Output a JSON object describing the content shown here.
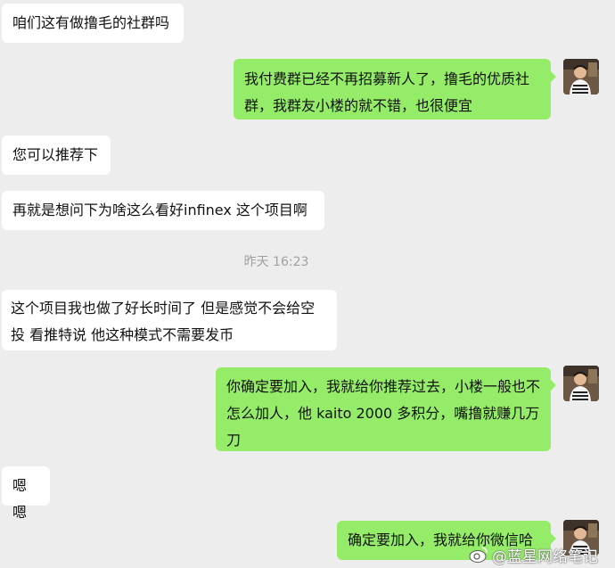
{
  "messages": [
    {
      "id": "m1",
      "side": "in",
      "text": "咱们这有做撸毛的社群吗"
    },
    {
      "id": "m2",
      "side": "out",
      "text": "我付费群已经不再招募新人了，撸毛的优质社群，我群友小楼的就不错，也很便宜"
    },
    {
      "id": "m3",
      "side": "in",
      "text": "您可以推荐下"
    },
    {
      "id": "m4",
      "side": "in",
      "text": "再就是想问下为啥这么看好infinex 这个项目啊"
    },
    {
      "id": "m5",
      "side": "in",
      "text": "这个项目我也做了好长时间了 但是感觉不会给空投 看推特说  他这种模式不需要发币"
    },
    {
      "id": "m6",
      "side": "out",
      "text": "你确定要加入，我就给你推荐过去，小楼一般也不怎么加人，他 kaito 2000 多积分，嘴撸就赚几万刀"
    },
    {
      "id": "m7",
      "side": "in",
      "text": "嗯嗯"
    },
    {
      "id": "m8",
      "side": "out",
      "text": "确定要加入，我就给你微信哈"
    }
  ],
  "timestamp": "昨天 16:23",
  "watermark": "@蓝星网络笔记",
  "colors": {
    "background": "#ededed",
    "incoming": "#ffffff",
    "outgoing": "#95ec69",
    "timestamp": "#a0a0a0"
  },
  "icons": {
    "avatar": "user-avatar-photo",
    "watermark": "weibo-logo-icon"
  }
}
